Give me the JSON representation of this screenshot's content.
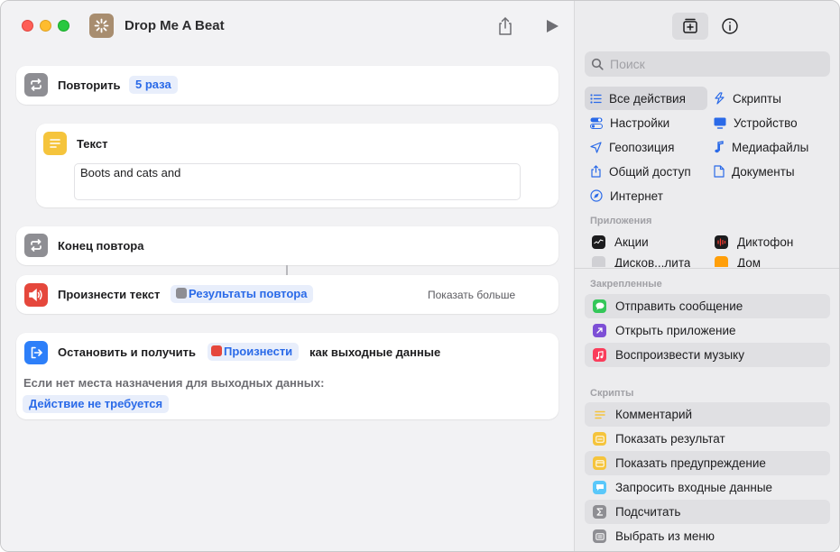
{
  "window": {
    "title": "Drop Me A Beat"
  },
  "colors": {
    "accent": "#2a6ae8",
    "repeat_icon": "#8e8e93",
    "text_icon": "#f5c43c",
    "speak_icon": "#e5473c",
    "stop_icon": "#2d7ff9"
  },
  "editor": {
    "repeat": {
      "label": "Повторить",
      "count": "5 раза"
    },
    "text_action": {
      "label": "Текст",
      "value": "Boots and cats and"
    },
    "end_repeat": {
      "label": "Конец повтора"
    },
    "speak": {
      "label": "Произнести текст",
      "variable": "Результаты повтора",
      "show_more": "Показать больше"
    },
    "stop": {
      "label": "Остановить и получить",
      "variable": "Произнести",
      "suffix": "как выходные данные",
      "fallback_label": "Если нет места назначения для выходных данных:",
      "fallback_value": "Действие не требуется"
    }
  },
  "library": {
    "search_placeholder": "Поиск",
    "categories": [
      {
        "label": "Все действия",
        "icon": "list-icon"
      },
      {
        "label": "Скрипты",
        "icon": "scripting-icon"
      },
      {
        "label": "Настройки",
        "icon": "toggles-icon"
      },
      {
        "label": "Устройство",
        "icon": "display-icon"
      },
      {
        "label": "Геопозиция",
        "icon": "location-arrow-icon"
      },
      {
        "label": "Медиафайлы",
        "icon": "music-note-icon"
      },
      {
        "label": "Общий доступ",
        "icon": "share-icon"
      },
      {
        "label": "Документы",
        "icon": "document-icon"
      },
      {
        "label": "Интернет",
        "icon": "compass-icon"
      }
    ],
    "apps_header": "Приложения",
    "apps": [
      {
        "label": "Акции",
        "icon": "stocks-app-icon"
      },
      {
        "label": "Диктофон",
        "icon": "voice-memos-app-icon"
      },
      {
        "label": "Дисков...лита",
        "icon": "disk-utility-app-icon"
      },
      {
        "label": "Дом",
        "icon": "home-app-icon"
      }
    ],
    "pinned_header": "Закрепленные",
    "pinned": [
      {
        "label": "Отправить сообщение",
        "icon": "messages-icon"
      },
      {
        "label": "Открыть приложение",
        "icon": "open-app-icon"
      },
      {
        "label": "Воспроизвести музыку",
        "icon": "music-icon"
      }
    ],
    "scripts_header": "Скрипты",
    "scripts": [
      {
        "label": "Комментарий",
        "icon": "comment-icon"
      },
      {
        "label": "Показать результат",
        "icon": "show-result-icon"
      },
      {
        "label": "Показать предупреждение",
        "icon": "alert-icon"
      },
      {
        "label": "Запросить входные данные",
        "icon": "ask-input-icon"
      },
      {
        "label": "Подсчитать",
        "icon": "count-sigma-icon"
      },
      {
        "label": "Выбрать из меню",
        "icon": "choose-menu-icon"
      }
    ]
  }
}
